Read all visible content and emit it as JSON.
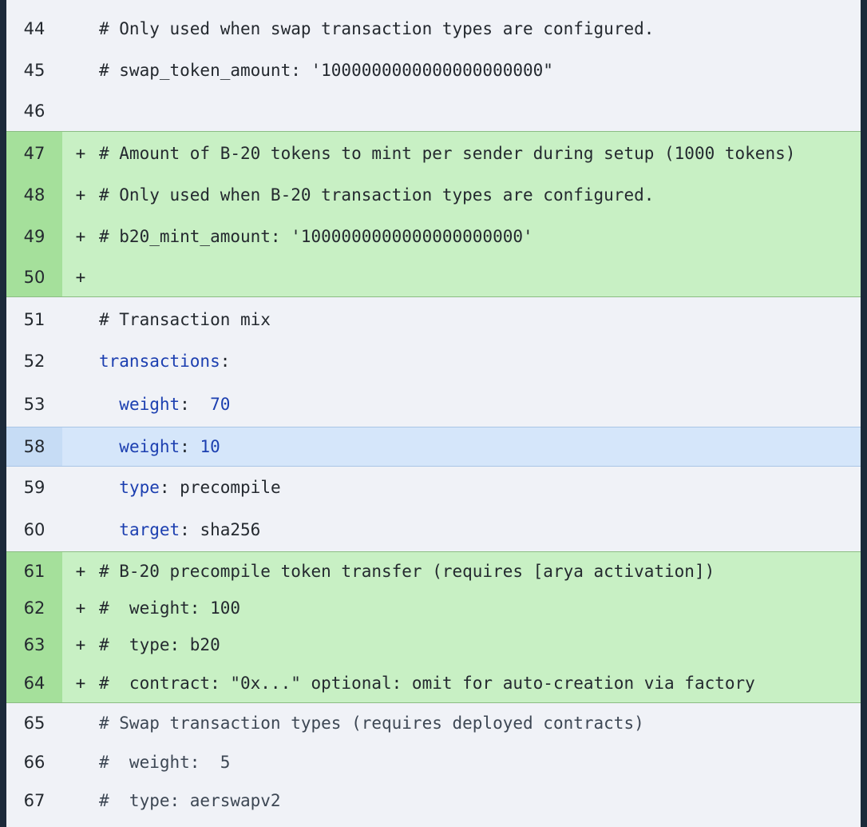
{
  "lines": [
    {
      "num": "44",
      "kind": "plain",
      "marker": "",
      "text": "# Only used when swap transaction types are configured."
    },
    {
      "num": "45",
      "kind": "plain",
      "marker": "",
      "text": "# swap_token_amount: '1000000000000000000000\""
    },
    {
      "num": "46",
      "kind": "plain",
      "marker": "",
      "text": ""
    },
    {
      "num": "47",
      "kind": "add",
      "marker": "+",
      "text": "# Amount of B-20 tokens to mint per sender during setup (1000 tokens)"
    },
    {
      "num": "48",
      "kind": "add",
      "marker": "+",
      "text": "# Only used when B-20 transaction types are configured."
    },
    {
      "num": "49",
      "kind": "add",
      "marker": "+",
      "text": "# b20_mint_amount: '1000000000000000000000'"
    },
    {
      "num": "50",
      "kind": "add",
      "marker": "+",
      "text": ""
    },
    {
      "num": "51",
      "kind": "plain",
      "marker": "",
      "text": "# Transaction mix"
    },
    {
      "num": "52",
      "kind": "plain",
      "marker": "",
      "key": "transactions",
      "sep": ":",
      "value": ""
    },
    {
      "num": "53",
      "kind": "plain",
      "marker": "",
      "indent": "  ",
      "key": "weight",
      "sep": ":  ",
      "value": "70",
      "valueIsNum": true
    },
    {
      "num": "58",
      "kind": "hl",
      "marker": "",
      "indent": "  ",
      "key": "weight",
      "sep": ": ",
      "value": "10",
      "valueIsNum": true
    },
    {
      "num": "59",
      "kind": "plain",
      "marker": "",
      "indent": "  ",
      "key": "type",
      "sep": ": ",
      "value": "precompile"
    },
    {
      "num": "60",
      "kind": "plain",
      "marker": "",
      "indent": "  ",
      "key": "target",
      "sep": ": ",
      "value": "sha256"
    },
    {
      "num": "61",
      "kind": "add",
      "marker": "+",
      "text": "# B-20 precompile token transfer (requires [arya activation])"
    },
    {
      "num": "62",
      "kind": "add",
      "marker": "+",
      "text": "#  weight: 100"
    },
    {
      "num": "63",
      "kind": "add",
      "marker": "+",
      "text": "#  type: b20"
    },
    {
      "num": "64",
      "kind": "add",
      "marker": "+",
      "text": "#  contract: \"0x...\" optional: omit for auto-creation via factory"
    },
    {
      "num": "65",
      "kind": "plain",
      "marker": "",
      "text": "# Swap transaction types (requires deployed contracts)",
      "dim": true
    },
    {
      "num": "66",
      "kind": "plain",
      "marker": "",
      "text": "#  weight:  5",
      "dim": true
    },
    {
      "num": "67",
      "kind": "plain",
      "marker": "",
      "text": "#  type: aerswapv2",
      "dim": true
    }
  ],
  "colors": {
    "added_bg": "#c8f0c4",
    "added_gutter": "#a5e09b",
    "highlight_bg": "#d5e6fa",
    "key_color": "#1c3fb0"
  }
}
